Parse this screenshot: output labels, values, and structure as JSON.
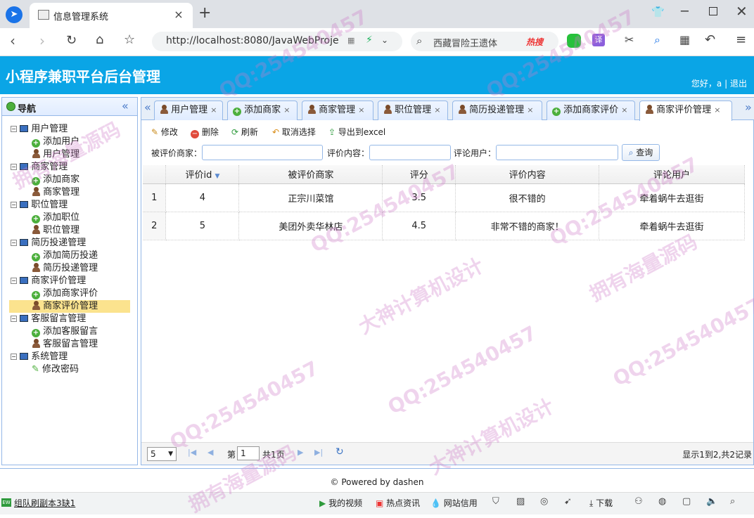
{
  "browser": {
    "tab_title": "信息管理系统",
    "url": "http://localhost:8080/JavaWebProje",
    "search_text": "西藏冒险王遗体",
    "hot_label": "热搜"
  },
  "app": {
    "title": "小程序兼职平台后台管理",
    "greeting": "您好，a",
    "sep": "|",
    "logout": "退出"
  },
  "sidebar": {
    "title": "导航",
    "groups": [
      {
        "label": "用户管理",
        "items": [
          {
            "label": "添加用户",
            "icon": "plus-icon"
          },
          {
            "label": "用户管理",
            "icon": "user-icon"
          }
        ]
      },
      {
        "label": "商家管理",
        "items": [
          {
            "label": "添加商家",
            "icon": "plus-icon"
          },
          {
            "label": "商家管理",
            "icon": "user-icon"
          }
        ]
      },
      {
        "label": "职位管理",
        "items": [
          {
            "label": "添加职位",
            "icon": "plus-icon"
          },
          {
            "label": "职位管理",
            "icon": "user-icon"
          }
        ]
      },
      {
        "label": "简历投递管理",
        "items": [
          {
            "label": "添加简历投递",
            "icon": "plus-icon"
          },
          {
            "label": "简历投递管理",
            "icon": "user-icon"
          }
        ]
      },
      {
        "label": "商家评价管理",
        "items": [
          {
            "label": "添加商家评价",
            "icon": "plus-icon"
          },
          {
            "label": "商家评价管理",
            "icon": "user-icon",
            "selected": true
          }
        ]
      },
      {
        "label": "客服留言管理",
        "items": [
          {
            "label": "添加客服留言",
            "icon": "plus-icon"
          },
          {
            "label": "客服留言管理",
            "icon": "user-icon"
          }
        ]
      },
      {
        "label": "系统管理",
        "items": [
          {
            "label": "修改密码",
            "icon": "pencil-icon"
          }
        ]
      }
    ]
  },
  "tabs": [
    {
      "label": "用户管理",
      "icon": "user-icon"
    },
    {
      "label": "添加商家",
      "icon": "plus-icon"
    },
    {
      "label": "商家管理",
      "icon": "user-icon"
    },
    {
      "label": "职位管理",
      "icon": "user-icon"
    },
    {
      "label": "简历投递管理",
      "icon": "user-icon"
    },
    {
      "label": "添加商家评价",
      "icon": "plus-icon"
    },
    {
      "label": "商家评价管理",
      "icon": "user-icon",
      "selected": true
    }
  ],
  "toolbar": {
    "edit": "修改",
    "delete": "删除",
    "refresh": "刷新",
    "unselect": "取消选择",
    "export": "导出到excel"
  },
  "filters": {
    "merchant_label": "被评价商家：",
    "content_label": "评价内容：",
    "user_label": "评论用户：",
    "query": "查询"
  },
  "grid": {
    "columns": [
      "评价id",
      "被评价商家",
      "评分",
      "评价内容",
      "评论用户"
    ],
    "rows": [
      {
        "rn": "1",
        "id": "4",
        "merchant": "正宗川菜馆",
        "score": "3.5",
        "content": "很不错的",
        "user": "牵着蜗牛去逛街"
      },
      {
        "rn": "2",
        "id": "5",
        "merchant": "美团外卖华林店",
        "score": "4.5",
        "content": "非常不错的商家！",
        "user": "牵着蜗牛去逛街"
      }
    ]
  },
  "pager": {
    "page_size": "5",
    "page_label": "第",
    "page": "1",
    "total_pages": "共1页",
    "summary": "显示1到2,共2记录"
  },
  "footer": {
    "text": "© Powered by dashen"
  },
  "statusbar": {
    "left": "组队刷副本3缺1",
    "video": "我的视频",
    "news": "热点资讯",
    "credit": "网站信用",
    "download": "下载"
  },
  "watermarks": [
    "QQ:254540457",
    "拥有海量源码",
    "大神计算机设计"
  ],
  "colors": {
    "header": "#0aa5e6",
    "border": "#95b8e7",
    "selected": "#fbe38e"
  }
}
